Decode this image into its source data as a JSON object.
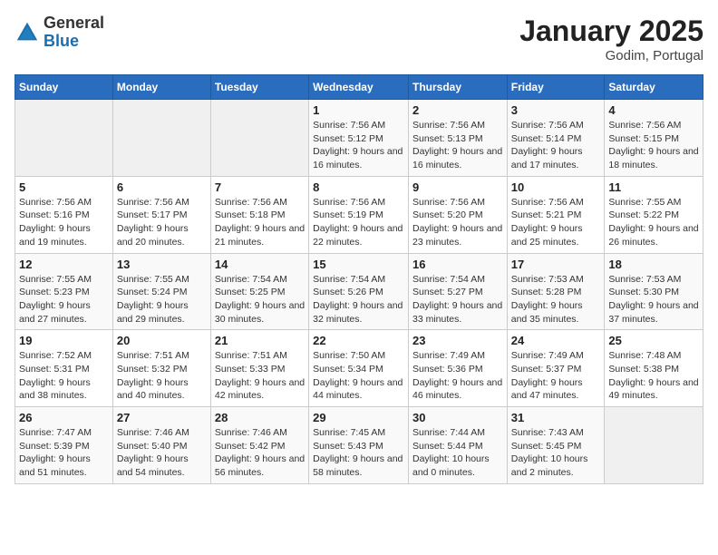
{
  "header": {
    "logo_general": "General",
    "logo_blue": "Blue",
    "month_year": "January 2025",
    "location": "Godim, Portugal"
  },
  "weekdays": [
    "Sunday",
    "Monday",
    "Tuesday",
    "Wednesday",
    "Thursday",
    "Friday",
    "Saturday"
  ],
  "weeks": [
    [
      {
        "day": "",
        "info": ""
      },
      {
        "day": "",
        "info": ""
      },
      {
        "day": "",
        "info": ""
      },
      {
        "day": "1",
        "info": "Sunrise: 7:56 AM\nSunset: 5:12 PM\nDaylight: 9 hours and 16 minutes."
      },
      {
        "day": "2",
        "info": "Sunrise: 7:56 AM\nSunset: 5:13 PM\nDaylight: 9 hours and 16 minutes."
      },
      {
        "day": "3",
        "info": "Sunrise: 7:56 AM\nSunset: 5:14 PM\nDaylight: 9 hours and 17 minutes."
      },
      {
        "day": "4",
        "info": "Sunrise: 7:56 AM\nSunset: 5:15 PM\nDaylight: 9 hours and 18 minutes."
      }
    ],
    [
      {
        "day": "5",
        "info": "Sunrise: 7:56 AM\nSunset: 5:16 PM\nDaylight: 9 hours and 19 minutes."
      },
      {
        "day": "6",
        "info": "Sunrise: 7:56 AM\nSunset: 5:17 PM\nDaylight: 9 hours and 20 minutes."
      },
      {
        "day": "7",
        "info": "Sunrise: 7:56 AM\nSunset: 5:18 PM\nDaylight: 9 hours and 21 minutes."
      },
      {
        "day": "8",
        "info": "Sunrise: 7:56 AM\nSunset: 5:19 PM\nDaylight: 9 hours and 22 minutes."
      },
      {
        "day": "9",
        "info": "Sunrise: 7:56 AM\nSunset: 5:20 PM\nDaylight: 9 hours and 23 minutes."
      },
      {
        "day": "10",
        "info": "Sunrise: 7:56 AM\nSunset: 5:21 PM\nDaylight: 9 hours and 25 minutes."
      },
      {
        "day": "11",
        "info": "Sunrise: 7:55 AM\nSunset: 5:22 PM\nDaylight: 9 hours and 26 minutes."
      }
    ],
    [
      {
        "day": "12",
        "info": "Sunrise: 7:55 AM\nSunset: 5:23 PM\nDaylight: 9 hours and 27 minutes."
      },
      {
        "day": "13",
        "info": "Sunrise: 7:55 AM\nSunset: 5:24 PM\nDaylight: 9 hours and 29 minutes."
      },
      {
        "day": "14",
        "info": "Sunrise: 7:54 AM\nSunset: 5:25 PM\nDaylight: 9 hours and 30 minutes."
      },
      {
        "day": "15",
        "info": "Sunrise: 7:54 AM\nSunset: 5:26 PM\nDaylight: 9 hours and 32 minutes."
      },
      {
        "day": "16",
        "info": "Sunrise: 7:54 AM\nSunset: 5:27 PM\nDaylight: 9 hours and 33 minutes."
      },
      {
        "day": "17",
        "info": "Sunrise: 7:53 AM\nSunset: 5:28 PM\nDaylight: 9 hours and 35 minutes."
      },
      {
        "day": "18",
        "info": "Sunrise: 7:53 AM\nSunset: 5:30 PM\nDaylight: 9 hours and 37 minutes."
      }
    ],
    [
      {
        "day": "19",
        "info": "Sunrise: 7:52 AM\nSunset: 5:31 PM\nDaylight: 9 hours and 38 minutes."
      },
      {
        "day": "20",
        "info": "Sunrise: 7:51 AM\nSunset: 5:32 PM\nDaylight: 9 hours and 40 minutes."
      },
      {
        "day": "21",
        "info": "Sunrise: 7:51 AM\nSunset: 5:33 PM\nDaylight: 9 hours and 42 minutes."
      },
      {
        "day": "22",
        "info": "Sunrise: 7:50 AM\nSunset: 5:34 PM\nDaylight: 9 hours and 44 minutes."
      },
      {
        "day": "23",
        "info": "Sunrise: 7:49 AM\nSunset: 5:36 PM\nDaylight: 9 hours and 46 minutes."
      },
      {
        "day": "24",
        "info": "Sunrise: 7:49 AM\nSunset: 5:37 PM\nDaylight: 9 hours and 47 minutes."
      },
      {
        "day": "25",
        "info": "Sunrise: 7:48 AM\nSunset: 5:38 PM\nDaylight: 9 hours and 49 minutes."
      }
    ],
    [
      {
        "day": "26",
        "info": "Sunrise: 7:47 AM\nSunset: 5:39 PM\nDaylight: 9 hours and 51 minutes."
      },
      {
        "day": "27",
        "info": "Sunrise: 7:46 AM\nSunset: 5:40 PM\nDaylight: 9 hours and 54 minutes."
      },
      {
        "day": "28",
        "info": "Sunrise: 7:46 AM\nSunset: 5:42 PM\nDaylight: 9 hours and 56 minutes."
      },
      {
        "day": "29",
        "info": "Sunrise: 7:45 AM\nSunset: 5:43 PM\nDaylight: 9 hours and 58 minutes."
      },
      {
        "day": "30",
        "info": "Sunrise: 7:44 AM\nSunset: 5:44 PM\nDaylight: 10 hours and 0 minutes."
      },
      {
        "day": "31",
        "info": "Sunrise: 7:43 AM\nSunset: 5:45 PM\nDaylight: 10 hours and 2 minutes."
      },
      {
        "day": "",
        "info": ""
      }
    ]
  ]
}
